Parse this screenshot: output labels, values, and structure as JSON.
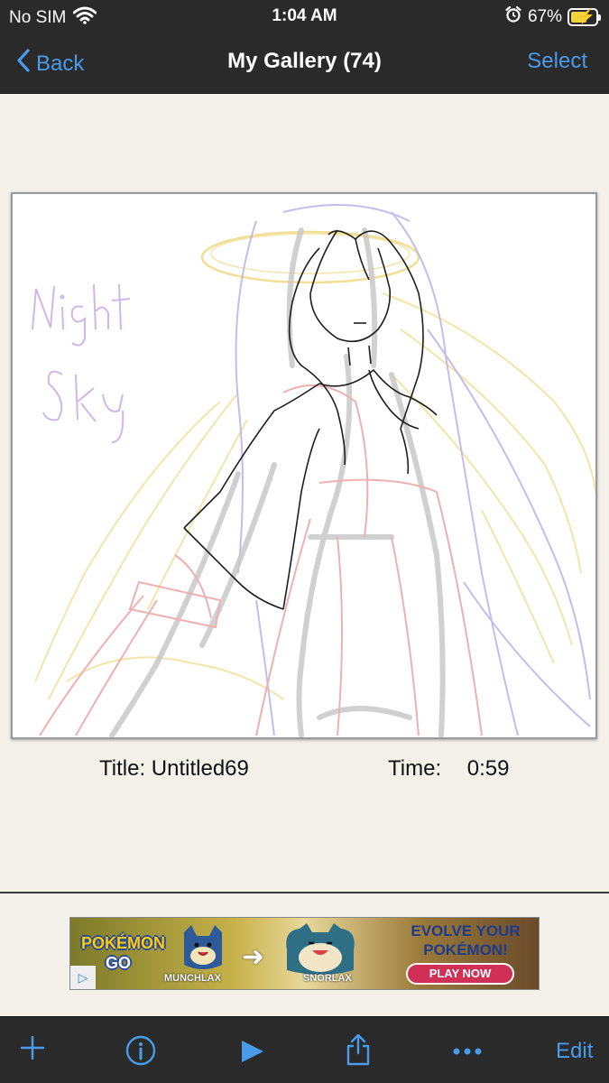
{
  "status_bar": {
    "carrier": "No SIM",
    "time": "1:04 AM",
    "battery_percent": "67%",
    "battery_level": 0.67
  },
  "nav": {
    "back_label": "Back",
    "title": "My Gallery (74)",
    "select_label": "Select"
  },
  "artwork": {
    "title_label": "Title:",
    "title_value": "Untitled69",
    "time_label": "Time:",
    "time_value": "0:59"
  },
  "ad": {
    "headline_1": "EVOLVE YOUR",
    "headline_2": "POKÉMON!",
    "cta": "PLAY NOW",
    "brand_1": "POKÉMON",
    "brand_2": "GO",
    "from_label": "MUNCHLAX",
    "to_label": "SNORLAX"
  },
  "toolbar": {
    "edit_label": "Edit",
    "icons": [
      "plus-icon",
      "info-icon",
      "play-icon",
      "share-icon",
      "more-icon"
    ]
  },
  "colors": {
    "accent": "#4a9bea",
    "bar_background": "#2a2a2a",
    "page_background": "#f3f1ea"
  }
}
